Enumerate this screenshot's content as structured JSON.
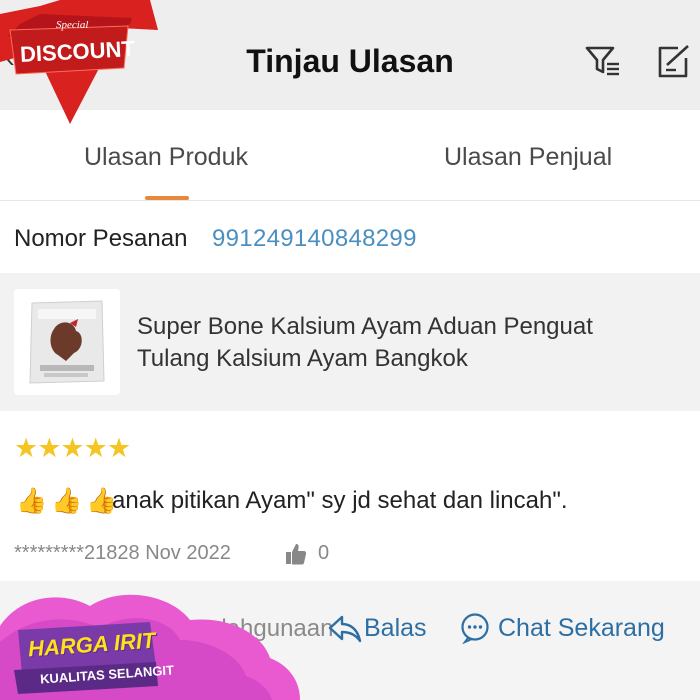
{
  "header": {
    "title": "Tinjau Ulasan",
    "back_icon": "back-icon",
    "filter_icon": "filter-icon",
    "edit_icon": "edit-icon"
  },
  "tabs": [
    {
      "label": "Ulasan Produk",
      "active": true
    },
    {
      "label": "Ulasan Penjual",
      "active": false
    }
  ],
  "order": {
    "label": "Nomor Pesanan",
    "number": "991249140848299"
  },
  "product": {
    "name_line1": "Super Bone Kalsium Ayam Aduan Penguat",
    "name_line2": "Tulang Kalsium Ayam Bangkok"
  },
  "review": {
    "rating": 5,
    "stars": "★★★★★",
    "emoji": [
      "👍",
      "👍",
      "👍"
    ],
    "text": "anak pitikan Ayam\" sy jd sehat dan lincah\".",
    "meta": "*********21828 Nov 2022",
    "likes": "0"
  },
  "actions": {
    "partial_text": "valahgunaan",
    "reply": "Balas",
    "chat": "Chat Sekarang"
  },
  "overlays": {
    "discount": "DISCOUNT",
    "special": "Special",
    "harga": "HARGA IRIT",
    "kualitas": "KUALITAS SELANGIT"
  },
  "colors": {
    "accent": "#e7883b",
    "link": "#4a8fbf",
    "action": "#2d6ea3",
    "star": "#f4c523"
  }
}
